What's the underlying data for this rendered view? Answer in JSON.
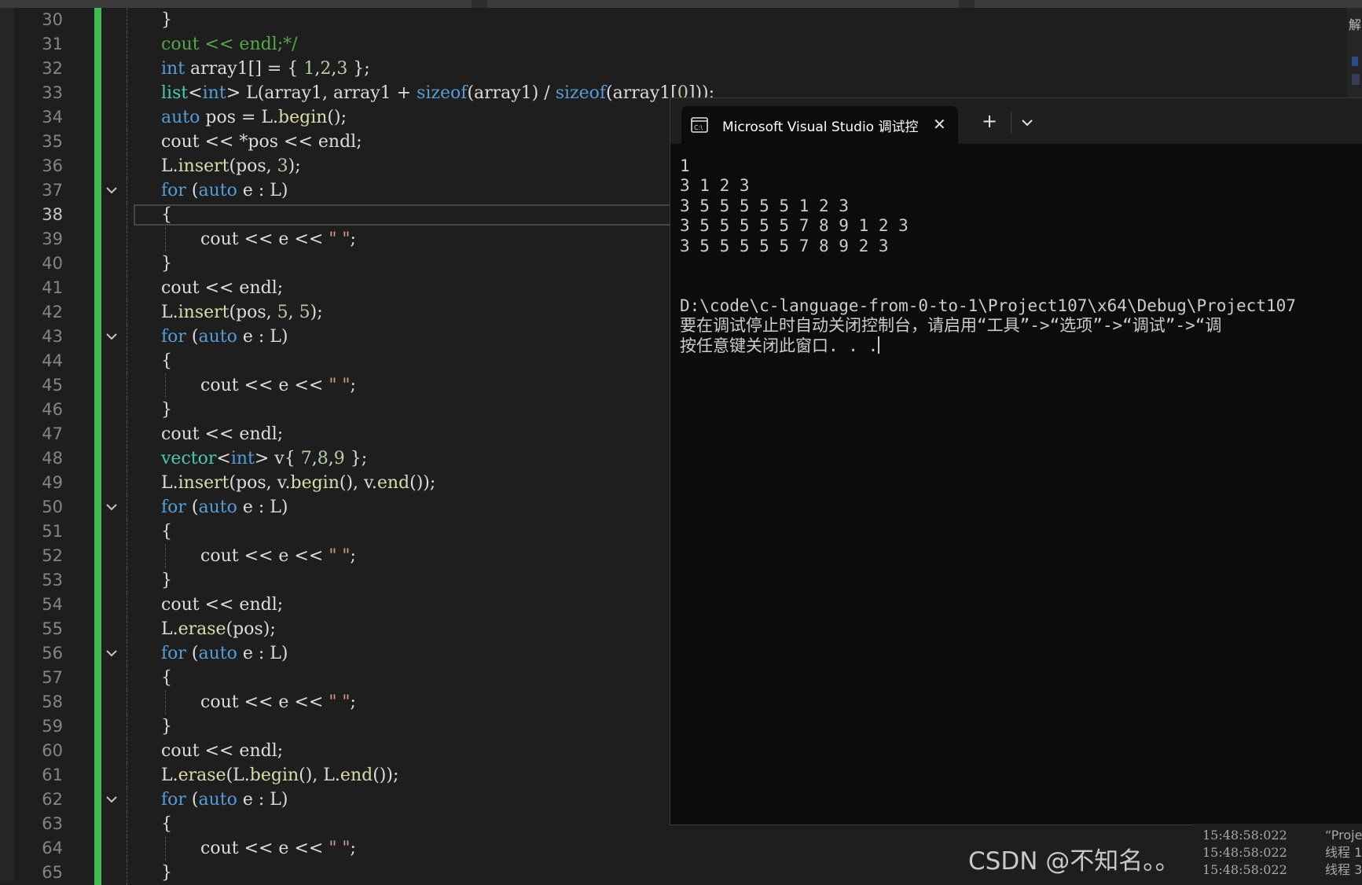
{
  "editor": {
    "lines": [
      {
        "n": "30",
        "html": "<span>}</span>",
        "ind": 1
      },
      {
        "n": "31",
        "html": "<span class='cm'>cout &lt;&lt; endl;*/</span>",
        "ind": 1
      },
      {
        "n": "32",
        "html": "<span class='kw'>int</span> array1[] = { <span class='nm'>1</span>,<span class='nm'>2</span>,<span class='nm'>3</span> };",
        "ind": 1
      },
      {
        "n": "33",
        "html": "<span class='ty'>list</span>&lt;<span class='kw'>int</span>&gt; L(array1, array1 + <span class='kw'>sizeof</span>(array1) / <span class='kw'>sizeof</span>(array1[<span class='nm'>0</span>]));",
        "ind": 1
      },
      {
        "n": "34",
        "html": "<span class='kw'>auto</span> pos = L.<span class='fn'>begin</span>();",
        "ind": 1
      },
      {
        "n": "35",
        "html": "cout &lt;&lt; *pos &lt;&lt; endl;",
        "ind": 1
      },
      {
        "n": "36",
        "html": "L.<span class='fn'>insert</span>(pos, <span class='nm'>3</span>);",
        "ind": 1
      },
      {
        "n": "37",
        "html": "<span class='kw'>for</span> (<span class='kw'>auto</span> e : L)",
        "ind": 1,
        "fold": true
      },
      {
        "n": "38",
        "html": "{",
        "ind": 1,
        "current": true
      },
      {
        "n": "39",
        "html": "cout &lt;&lt; e &lt;&lt; <span class='st'>\" \"</span>;",
        "ind": 2
      },
      {
        "n": "40",
        "html": "}",
        "ind": 1
      },
      {
        "n": "41",
        "html": "cout &lt;&lt; endl;",
        "ind": 1
      },
      {
        "n": "42",
        "html": "L.<span class='fn'>insert</span>(pos, <span class='nm'>5</span>, <span class='nm'>5</span>);",
        "ind": 1
      },
      {
        "n": "43",
        "html": "<span class='kw'>for</span> (<span class='kw'>auto</span> e : L)",
        "ind": 1,
        "fold": true
      },
      {
        "n": "44",
        "html": "{",
        "ind": 1
      },
      {
        "n": "45",
        "html": "cout &lt;&lt; e &lt;&lt; <span class='st'>\" \"</span>;",
        "ind": 2
      },
      {
        "n": "46",
        "html": "}",
        "ind": 1
      },
      {
        "n": "47",
        "html": "cout &lt;&lt; endl;",
        "ind": 1
      },
      {
        "n": "48",
        "html": "<span class='ty'>vector</span>&lt;<span class='kw'>int</span>&gt; v{ <span class='nm'>7</span>,<span class='nm'>8</span>,<span class='nm'>9</span> };",
        "ind": 1
      },
      {
        "n": "49",
        "html": "L.<span class='fn'>insert</span>(pos, v.<span class='fn'>begin</span>(), v.<span class='fn'>end</span>());",
        "ind": 1
      },
      {
        "n": "50",
        "html": "<span class='kw'>for</span> (<span class='kw'>auto</span> e : L)",
        "ind": 1,
        "fold": true
      },
      {
        "n": "51",
        "html": "{",
        "ind": 1
      },
      {
        "n": "52",
        "html": "cout &lt;&lt; e &lt;&lt; <span class='st'>\" \"</span>;",
        "ind": 2
      },
      {
        "n": "53",
        "html": "}",
        "ind": 1
      },
      {
        "n": "54",
        "html": "cout &lt;&lt; endl;",
        "ind": 1
      },
      {
        "n": "55",
        "html": "L.<span class='fn'>erase</span>(pos);",
        "ind": 1
      },
      {
        "n": "56",
        "html": "<span class='kw'>for</span> (<span class='kw'>auto</span> e : L)",
        "ind": 1,
        "fold": true
      },
      {
        "n": "57",
        "html": "{",
        "ind": 1
      },
      {
        "n": "58",
        "html": "cout &lt;&lt; e &lt;&lt; <span class='st'>\" \"</span>;",
        "ind": 2
      },
      {
        "n": "59",
        "html": "}",
        "ind": 1
      },
      {
        "n": "60",
        "html": "cout &lt;&lt; endl;",
        "ind": 1
      },
      {
        "n": "61",
        "html": "L.<span class='fn'>erase</span>(L.<span class='fn'>begin</span>(), L.<span class='fn'>end</span>());",
        "ind": 1
      },
      {
        "n": "62",
        "html": "<span class='kw'>for</span> (<span class='kw'>auto</span> e : L)",
        "ind": 1,
        "fold": true
      },
      {
        "n": "63",
        "html": "{",
        "ind": 1
      },
      {
        "n": "64",
        "html": "cout &lt;&lt; e &lt;&lt; <span class='st'>\" \"</span>;",
        "ind": 2
      },
      {
        "n": "65",
        "html": "}",
        "ind": 1
      }
    ]
  },
  "terminal": {
    "tab_title": "Microsoft Visual Studio 调试控",
    "tab_icon": "console-icon",
    "close_glyph": "✕",
    "new_tab_glyph": "+",
    "output": [
      "1",
      "3 1 2 3",
      "3 5 5 5 5 5 1 2 3",
      "3 5 5 5 5 5 7 8 9 1 2 3",
      "3 5 5 5 5 5 7 8 9 2 3",
      "",
      "",
      "D:\\code\\c-language-from-0-to-1\\Project107\\x64\\Debug\\Project107",
      "要在调试停止时自动关闭控制台，请启用“工具”->“选项”->“调试”->“调",
      "按任意键关闭此窗口. . ."
    ]
  },
  "right_panel": {
    "glyph": "解"
  },
  "output_log": {
    "rows": [
      {
        "time": "15:48:58:022",
        "msg": "“Proje"
      },
      {
        "time": "15:48:58:022",
        "msg": "线程 1"
      },
      {
        "time": "15:48:58:022",
        "msg": "线程 3"
      }
    ]
  },
  "watermark": "CSDN @不知名。。",
  "colors": {
    "editor_bg": "#1e1e1e",
    "terminal_bg": "#0c0c0c",
    "change_bar": "#3fb950",
    "keyword": "#569cd6",
    "type": "#4ec9b0",
    "function": "#dcdcaa",
    "number": "#b5cea8",
    "string": "#d69d85",
    "comment": "#57a64a"
  }
}
